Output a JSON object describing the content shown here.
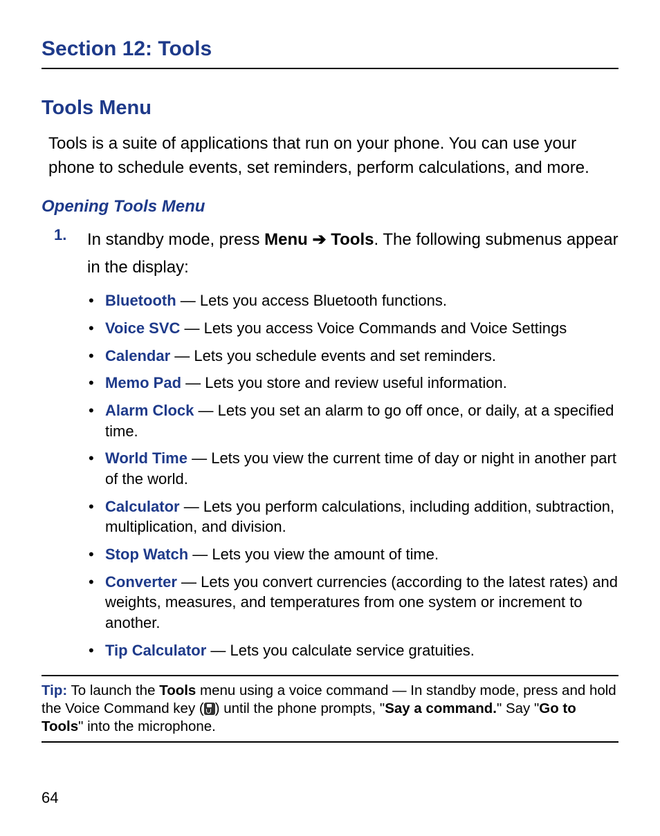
{
  "section_title": "Section 12: Tools",
  "h1": "Tools Menu",
  "intro": "Tools is a suite of applications that run on your phone. You can use your phone to schedule events, set reminders, perform calculations, and more.",
  "h2": "Opening Tools Menu",
  "step": {
    "num": "1.",
    "pre": "In standby mode, press ",
    "menu": "Menu",
    "arrow": " ➔ ",
    "tools": "Tools",
    "post": ". The following submenus appear in the display:"
  },
  "items": [
    {
      "term": "Bluetooth",
      "desc": " — Lets you access Bluetooth functions."
    },
    {
      "term": "Voice SVC",
      "desc": " — Lets you access Voice Commands and Voice Settings"
    },
    {
      "term": "Calendar",
      "desc": " — Lets you schedule events and set reminders."
    },
    {
      "term": "Memo Pad",
      "desc": " — Lets you store and review useful information."
    },
    {
      "term": "Alarm Clock",
      "desc": " — Lets you set an alarm to go off once, or daily, at a specified time."
    },
    {
      "term": "World Time",
      "desc": " — Lets you view the current time of day or night in another part of the world."
    },
    {
      "term": "Calculator",
      "desc": " — Lets you perform calculations, including addition, subtraction, multiplication, and division."
    },
    {
      "term": "Stop Watch",
      "desc": " — Lets you view the amount of time."
    },
    {
      "term": "Converter",
      "desc": " — Lets you convert currencies (according to the latest rates) and weights, measures, and temperatures from one system or increment to another."
    },
    {
      "term": "Tip Calculator",
      "desc": " — Lets you calculate service gratuities."
    }
  ],
  "tip": {
    "label": "Tip:",
    "t1": " To launch the ",
    "b1": "Tools",
    "t2": " menu using a voice command — In standby mode, press and hold the Voice Command key (",
    "t3": ") until the phone prompts, \"",
    "b2": "Say a command.",
    "t4": "\" Say \"",
    "b3": "Go to Tools",
    "t5": "\" into the microphone."
  },
  "page_num": "64"
}
